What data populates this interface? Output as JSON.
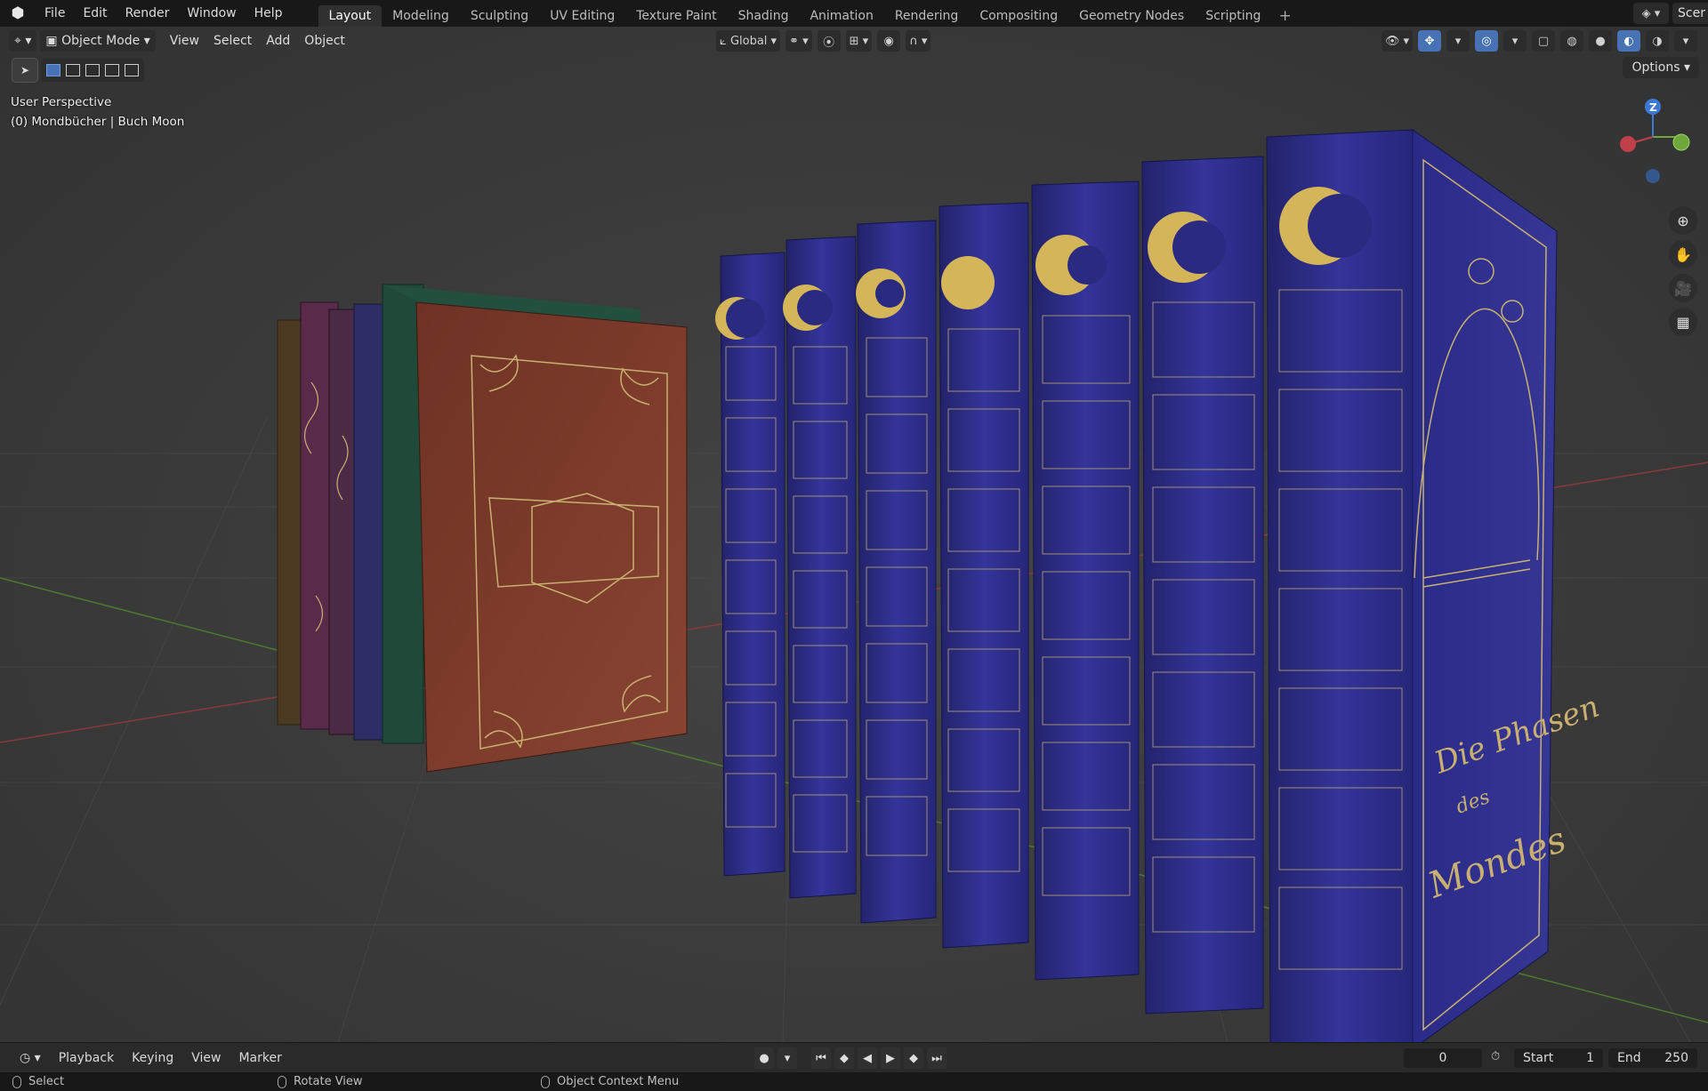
{
  "topbar": {
    "logo_icon": "blender-icon",
    "menu": [
      "File",
      "Edit",
      "Render",
      "Window",
      "Help"
    ],
    "tabs": [
      {
        "label": "Layout",
        "active": true
      },
      {
        "label": "Modeling"
      },
      {
        "label": "Sculpting"
      },
      {
        "label": "UV Editing"
      },
      {
        "label": "Texture Paint"
      },
      {
        "label": "Shading"
      },
      {
        "label": "Animation"
      },
      {
        "label": "Rendering"
      },
      {
        "label": "Compositing"
      },
      {
        "label": "Geometry Nodes"
      },
      {
        "label": "Scripting"
      }
    ],
    "add_tab": "+",
    "scene_label": "Scer"
  },
  "viewport_header": {
    "editor_type_icon": "3d-viewport-icon",
    "mode": "Object Mode",
    "menu": [
      "View",
      "Select",
      "Add",
      "Object"
    ],
    "transform_orientation": "Global",
    "options_label": "Options"
  },
  "overlay": {
    "perspective": "User Perspective",
    "object_info": "(0) Mondbücher | Buch Moon"
  },
  "gizmo": {
    "z_label": "Z"
  },
  "timeline": {
    "menu": [
      "Playback",
      "Keying",
      "View",
      "Marker"
    ],
    "current_frame": "0",
    "start_label": "Start",
    "start_value": "1",
    "end_label": "End",
    "end_value": "250"
  },
  "statusbar": {
    "select": "Select",
    "rotate_view": "Rotate View",
    "context_menu": "Object Context Menu"
  },
  "colors": {
    "accent": "#4772b3",
    "book_blue": "#2f2f8a",
    "book_brown": "#7a3a2a",
    "gold": "#c9b070"
  }
}
